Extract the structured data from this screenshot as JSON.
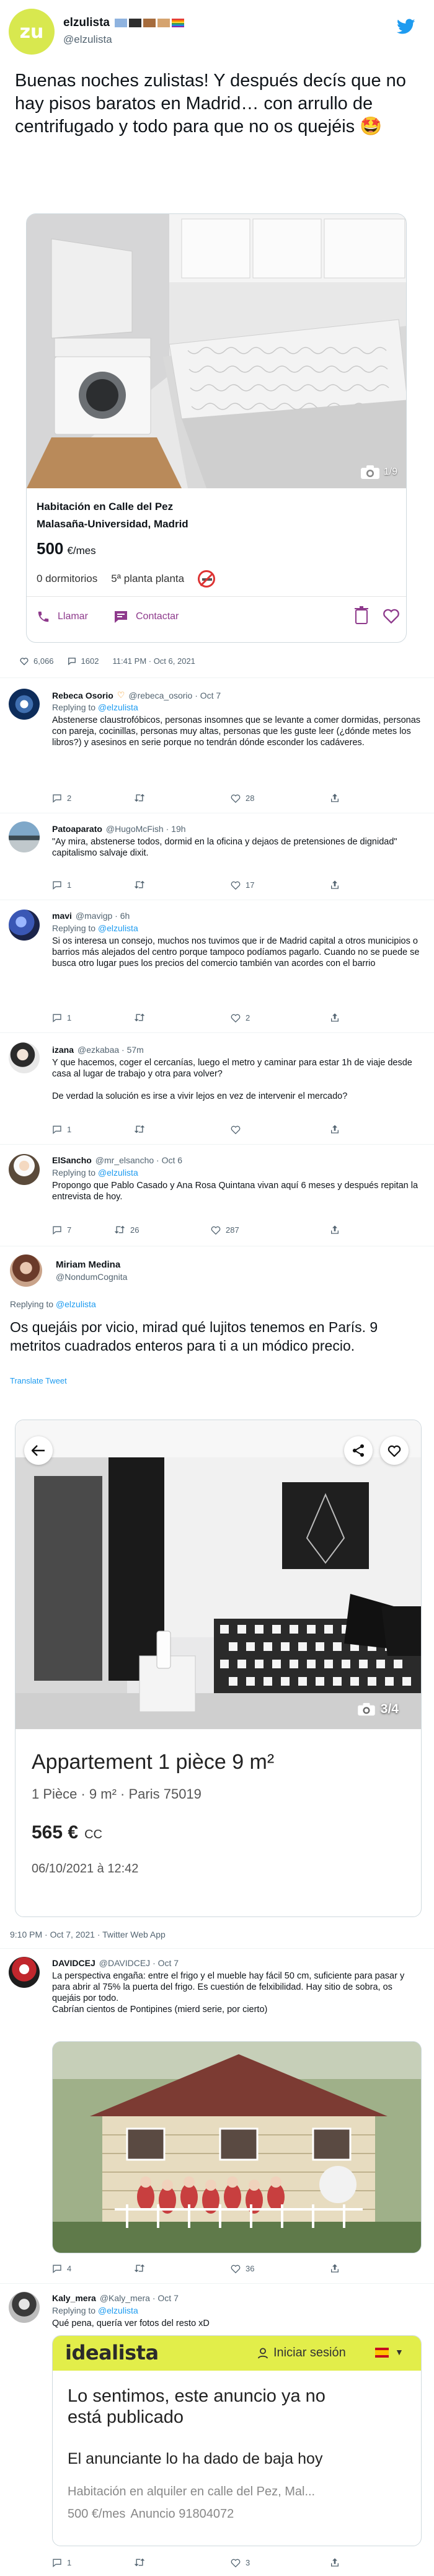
{
  "main_tweet": {
    "display_name": "elzulista",
    "handle": "@elzulista",
    "flag_colors": [
      "#8fb3df",
      "#2e2e2e",
      "#a66c3d",
      "#d5a36f",
      "#e5a55a"
    ],
    "text": "Buenas noches zulistas! Y después decís que no hay pisos baratos en Madrid… con arrullo de centrifugado y todo para que no os quejéis 🤩",
    "card": {
      "photo_counter": "1/9",
      "title": "Habitación en Calle del Pez",
      "location": "Malasaña-Universidad, Madrid",
      "price": "500",
      "price_unit": "€/mes",
      "rooms": "0 dormitorios",
      "floor": "5ª planta planta",
      "call_label": "Llamar",
      "contact_label": "Contactar"
    },
    "likes": "6,066",
    "replies": "1602",
    "timestamp": "11:41 PM · Oct 6, 2021"
  },
  "replies": [
    {
      "name": "Rebeca Osorio",
      "handle_meta": "@rebeca_osorio · Oct 7",
      "replying_prefix": "Replying to ",
      "replying_to": "@elzulista",
      "text": "Abstenerse claustrofóbicos, personas insomnes que se levante a comer dormidas, personas con pareja, cocinillas, personas muy altas, personas que les guste leer (¿dónde metes los libros?) y asesinos en serie porque no tendrán dónde esconder los cadáveres.",
      "reply_count": "2",
      "retweet_count": "",
      "like_count": "28"
    },
    {
      "name": "Patoaparato",
      "handle_meta": "@HugoMcFish · 19h",
      "text": "\"Ay mira, abstenerse todos, dormid en la oficina y dejaos de pretensiones de dignidad\" capitalismo salvaje dixit.",
      "reply_count": "1",
      "retweet_count": "",
      "like_count": "17"
    },
    {
      "name": "mavi",
      "handle_meta": "@mavigp · 6h",
      "replying_prefix": "Replying to ",
      "replying_to": "@elzulista",
      "text": "Si os interesa un consejo, muchos nos tuvimos que ir de Madrid capital a otros municipios o barrios más alejados del centro porque tampoco podíamos pagarlo. Cuando no se puede se busca otro lugar pues los precios del comercio también van acordes con el barrio",
      "reply_count": "1",
      "retweet_count": "",
      "like_count": "2"
    },
    {
      "name": "izana",
      "handle_meta": "@ezkabaa · 57m",
      "text1": "Y que hacemos, coger el cercanías, luego el metro y caminar para estar 1h de viaje desde casa al lugar de trabajo y otra para volver?",
      "text2": "De verdad la solución es irse a vivir lejos en vez de intervenir el mercado?",
      "reply_count": "1",
      "retweet_count": "",
      "like_count": ""
    },
    {
      "name": "ElSancho",
      "handle_meta": "@mr_elsancho · Oct 6",
      "replying_prefix": "Replying to ",
      "replying_to": "@elzulista",
      "text": "Propongo que Pablo Casado y Ana Rosa Quintana vivan aquí 6 meses y después repitan la entrevista de hoy.",
      "reply_count": "7",
      "retweet_count": "26",
      "like_count": "287"
    }
  ],
  "focus_tweet": {
    "name": "Miriam Medina",
    "handle": "@NondumCognita",
    "replying_prefix": "Replying to ",
    "replying_to": "@elzulista",
    "text": "Os quejáis por vicio, mirad qué lujitos tenemos en París. 9 metritos cuadrados enteros para ti a un módico precio.",
    "translate": "Translate Tweet",
    "card": {
      "photo_counter": "3/4",
      "title": "Appartement 1 pièce 9 m²",
      "details": "1 Pièce · 9 m² · Paris 75019",
      "price": "565 €",
      "price_suffix": "CC",
      "date": "06/10/2021 à 12:42"
    },
    "meta": "9:10 PM · Oct 7, 2021 · Twitter Web App"
  },
  "replies_after": [
    {
      "name": "DAVIDCEJ",
      "handle_meta": "@DAVIDCEJ · Oct 7",
      "text": "La perspectiva engaña: entre el frigo y el mueble hay fácil 50 cm, suficiente para pasar y para abrir al 75% la puerta del frigo. Es cuestión de felxibilidad. Hay sitio de sobra, os quejáis por todo.\nCabrían cientos de Pontipines (mierd serie, por cierto)",
      "reply_count": "4",
      "retweet_count": "",
      "like_count": "36"
    },
    {
      "name": "Kaly_mera",
      "handle_meta": "@Kaly_mera · Oct 7",
      "replying_prefix": "Replying to ",
      "replying_to": "@elzulista",
      "text": "Qué pena, quería ver fotos del resto xD",
      "idealista": {
        "logo": "idealista",
        "login": "Iniciar sesión",
        "headline": "Lo sentimos, este anuncio ya no está publicado",
        "sub": "El anunciante lo ha dado de baja hoy",
        "listing": "Habitación en alquiler en calle del Pez, Mal...",
        "price": "500 €/mes",
        "ad": "Anuncio 91804072"
      },
      "reply_count": "1",
      "retweet_count": "",
      "like_count": "3"
    }
  ]
}
